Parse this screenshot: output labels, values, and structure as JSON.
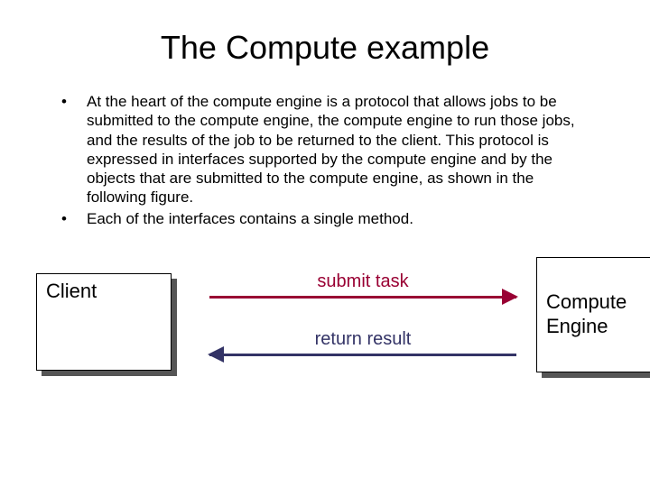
{
  "title": "The Compute example",
  "bullets": [
    "At the heart of the compute engine is a protocol that allows jobs to be submitted to the compute engine, the compute engine to run those jobs, and the results of the job to be returned to the client. This protocol is expressed in interfaces supported by the compute engine and by the objects that are submitted to the compute engine, as shown in the following figure.",
    " Each of the interfaces contains a single method."
  ],
  "diagram": {
    "client_label": "Client",
    "engine_label_line1": "Compute",
    "engine_label_line2": "Engine",
    "submit_label": "submit task",
    "return_label": "return result",
    "colors": {
      "submit": "#990033",
      "return": "#333366"
    }
  }
}
